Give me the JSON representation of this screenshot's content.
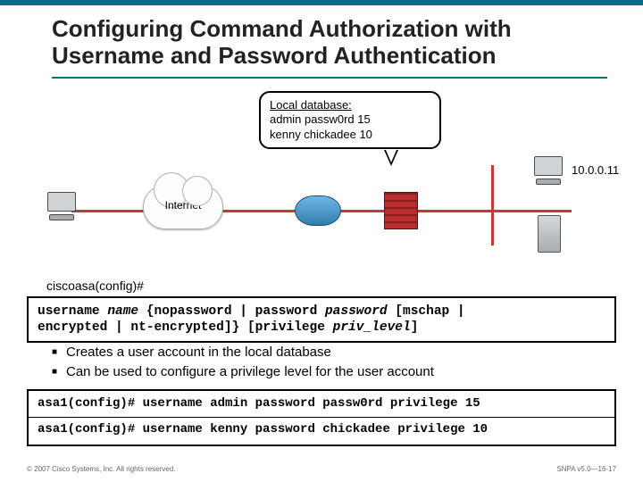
{
  "title": "Configuring Command Authorization with Username and Password Authentication",
  "local_db": {
    "heading": "Local database:",
    "line1": "admin  passw0rd  15",
    "line2": "kenny  chickadee  10"
  },
  "diagram": {
    "internet_label": "Internet",
    "host_ip": "10.0.0.11"
  },
  "prompt": "ciscoasa(config)#",
  "syntax": {
    "l1a": "username ",
    "l1_name": "name",
    "l1b": " {nopassword | password ",
    "l1_pw": "password",
    "l1c": " [mschap |",
    "l2a": "  encrypted | nt-encrypted]} [privilege ",
    "l2_priv": "priv_level",
    "l2b": "]"
  },
  "bullets": {
    "b1": "Creates a user account in the local database",
    "b2": "Can be used to configure a privilege level for the user account"
  },
  "examples": {
    "e1": "asa1(config)# username admin password passw0rd privilege 15",
    "e2": "asa1(config)# username kenny password chickadee privilege 10"
  },
  "footer": {
    "left": "© 2007 Cisco Systems, Inc. All rights reserved.",
    "right": "SNPA v5.0—16-17"
  }
}
